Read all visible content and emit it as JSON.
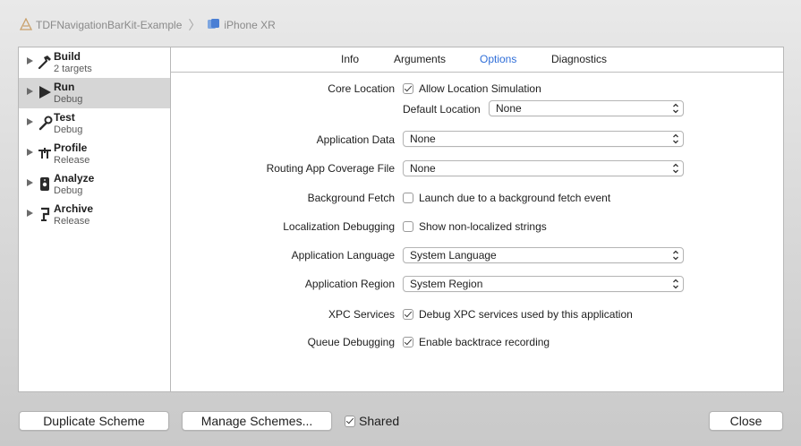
{
  "breadcrumb": {
    "project": "TDFNavigationBarKit-Example",
    "separator": "〉",
    "device": "iPhone XR"
  },
  "sidebar": {
    "items": [
      {
        "title": "Build",
        "subtitle": "2 targets",
        "icon": "hammer-icon"
      },
      {
        "title": "Run",
        "subtitle": "Debug",
        "icon": "play-icon",
        "selected": true
      },
      {
        "title": "Test",
        "subtitle": "Debug",
        "icon": "wrench-icon"
      },
      {
        "title": "Profile",
        "subtitle": "Release",
        "icon": "instruments-icon"
      },
      {
        "title": "Analyze",
        "subtitle": "Debug",
        "icon": "analyze-icon"
      },
      {
        "title": "Archive",
        "subtitle": "Release",
        "icon": "archive-icon"
      }
    ]
  },
  "tabs": {
    "items": [
      "Info",
      "Arguments",
      "Options",
      "Diagnostics"
    ],
    "active": "Options"
  },
  "options": {
    "core_location": {
      "label": "Core Location",
      "checkbox": "Allow Location Simulation",
      "checked": true,
      "default_location_label": "Default Location",
      "default_location_value": "None"
    },
    "application_data": {
      "label": "Application Data",
      "value": "None"
    },
    "routing_coverage": {
      "label": "Routing App Coverage File",
      "value": "None"
    },
    "background_fetch": {
      "label": "Background Fetch",
      "checkbox": "Launch due to a background fetch event",
      "checked": false
    },
    "localization_debugging": {
      "label": "Localization Debugging",
      "checkbox": "Show non-localized strings",
      "checked": false
    },
    "application_language": {
      "label": "Application Language",
      "value": "System Language"
    },
    "application_region": {
      "label": "Application Region",
      "value": "System Region"
    },
    "xpc_services": {
      "label": "XPC Services",
      "checkbox": "Debug XPC services used by this application",
      "checked": true
    },
    "queue_debugging": {
      "label": "Queue Debugging",
      "checkbox": "Enable backtrace recording",
      "checked": true
    }
  },
  "footer": {
    "duplicate_label": "Duplicate Scheme",
    "manage_label": "Manage Schemes...",
    "shared_label": "Shared",
    "shared_checked": true,
    "close_label": "Close"
  },
  "colors": {
    "accent": "#2f6ed8",
    "selection": "#d6d6d6"
  }
}
